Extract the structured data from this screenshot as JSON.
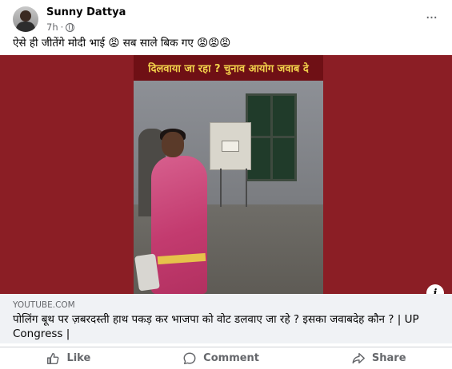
{
  "post": {
    "author": "Sunny Dattya",
    "timestamp": "7h",
    "timestamp_separator": "·",
    "more_options_label": "···",
    "caption": "ऐसे ही जीतेंगे मोदी भाई 😡 सब साले बिक गए 😡😡😡",
    "media": {
      "banner_text": "दिलवाया जा रहा ? चुनाव आयोग जवाब दे",
      "info_label": "i"
    },
    "link_preview": {
      "domain": "YOUTUBE.COM",
      "title": "पोलिंग बूथ पर ज़बरदस्ती हाथ पकड़ कर भाजपा को वोट डलवाए जा रहे ? इसका जवाबदेह कौन ? | UP Congress |"
    },
    "actions": [
      {
        "label": "Like",
        "icon": "like-icon"
      },
      {
        "label": "Comment",
        "icon": "comment-icon"
      },
      {
        "label": "Share",
        "icon": "share-icon"
      }
    ]
  },
  "colors": {
    "text_primary": "#050505",
    "text_secondary": "#65676b",
    "link_box_bg": "#f0f2f5",
    "media_bg": "#8b1e25",
    "banner_text": "#f2d14b"
  }
}
